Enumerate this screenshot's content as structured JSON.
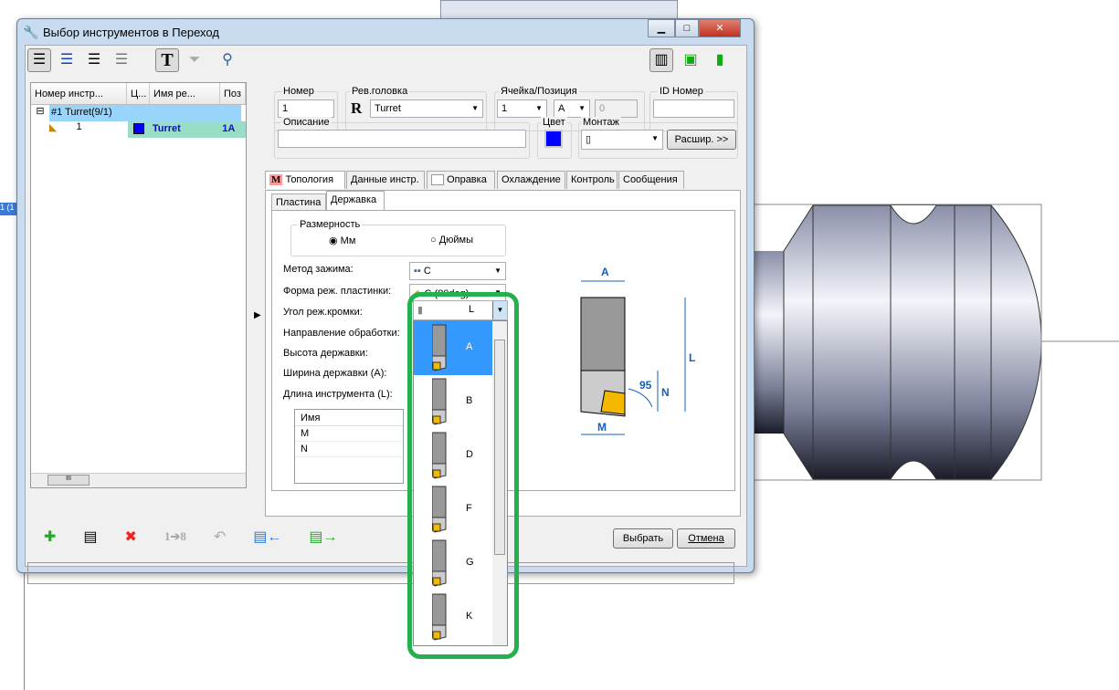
{
  "window": {
    "title": "Выбор инструментов в Переход",
    "min": "▁",
    "max": "□",
    "close": "✕"
  },
  "left_marker": "1 (1",
  "grid": {
    "columns": [
      "Номер инстр...",
      "Ц...",
      "Имя ре...",
      "Поз"
    ],
    "group_row": "#1 Turret(9/1)",
    "rows": [
      {
        "number": "1",
        "color": "#0000ff",
        "name": "Turret",
        "pos": "1A"
      }
    ],
    "scroll_grip": "III"
  },
  "fields": {
    "number_label": "Номер",
    "number_value": "1",
    "turret_label": "Рев.головка",
    "turret_value": "Turret",
    "turret_icon": "R",
    "cell_label": "Ячейка/Позиция",
    "cell_value": "1",
    "pos_value": "A",
    "pos_num": "0",
    "id_label": "ID Номер",
    "id_value": "",
    "desc_label": "Описание",
    "desc_value": "",
    "color_label": "Цвет",
    "color_value": "#0000ff",
    "mount_label": "Монтаж",
    "expand_button": "Расшир. >>"
  },
  "tabs": [
    "Топология",
    "Данные инстр.",
    "Оправка",
    "Охлаждение",
    "Контроль",
    "Сообщения"
  ],
  "tab_icon": "M",
  "subtabs": [
    "Пластина",
    "Державка"
  ],
  "holder": {
    "units_label": "Размерность",
    "unit_mm": "Мм",
    "unit_in": "Дюймы",
    "unit_selected": "Мм",
    "clamp_label": "Метод зажима:",
    "clamp_value": "C",
    "insert_label": "Форма реж. пластинки:",
    "insert_value": "C (80deg)",
    "angle_label": "Угол реж.кромки:",
    "angle_value": "L",
    "direction_label": "Направление обработки:",
    "height_label": "Высота державки:",
    "width_label": "Ширина державки (A):",
    "length_label": "Длина инструмента (L):",
    "table_header": "Имя",
    "table_rows": [
      "M",
      "N"
    ]
  },
  "angle_options": [
    "A",
    "B",
    "D",
    "F",
    "G",
    "K"
  ],
  "angle_selected": "A",
  "diagram": {
    "A": "A",
    "L": "L",
    "N": "N",
    "M": "M",
    "angle": "95"
  },
  "actions": {
    "select": "Выбрать",
    "cancel": "Отмена"
  },
  "bottom_toolbar": [
    "add-tool-icon",
    "copy-list-icon",
    "delete-icon",
    "renumber-icon",
    "undo-icon",
    "import-icon",
    "export-icon"
  ],
  "renumber_text": "1➔8",
  "colors": {
    "highlight": "#3399ff",
    "group_row": "#99d5fb",
    "tool_row": "#99dcc8",
    "accent_green": "#22b14c"
  }
}
